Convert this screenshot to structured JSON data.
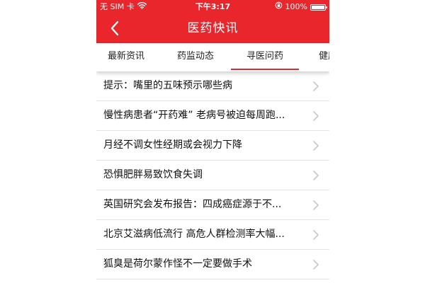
{
  "status_bar": {
    "carrier": "无 SIM 卡",
    "time": "下午3:17",
    "battery_percent": "100%",
    "battery_level": 1.0,
    "icons": [
      "wifi-icon",
      "orientation-lock-icon",
      "battery-icon"
    ]
  },
  "nav": {
    "title": "医药快讯",
    "back_icon": "back-chevron-icon"
  },
  "tabs": [
    {
      "label": "最新资讯",
      "active": false
    },
    {
      "label": "药监动态",
      "active": false
    },
    {
      "label": "寻医问药",
      "active": true
    },
    {
      "label": "健康",
      "active": false
    }
  ],
  "articles": [
    {
      "title": "提示：嘴里的五味预示哪些病"
    },
    {
      "title": "慢性病患者“开药难” 老病号被迫每周跑..."
    },
    {
      "title": "月经不调女性经期或会视力下降"
    },
    {
      "title": "恐惧肥胖易致饮食失调"
    },
    {
      "title": "英国研究会发布报告：四成癌症源于不..."
    },
    {
      "title": "北京艾滋病低流行 高危人群检测率大幅..."
    },
    {
      "title": "狐臭是荷尔蒙作怪不一定要做手术"
    }
  ],
  "colors": {
    "brand_red": "#e8262b",
    "chevron_gray": "#c7c7cc",
    "divider": "#e3e3e3"
  }
}
